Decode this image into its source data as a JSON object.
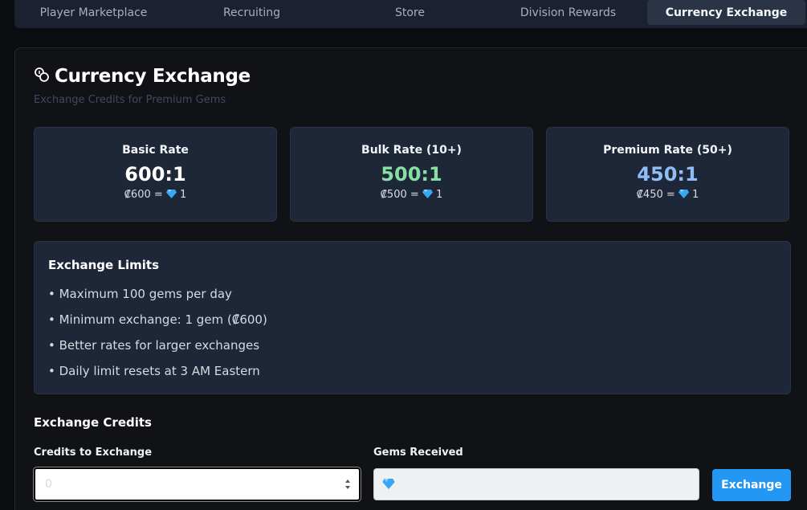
{
  "tabs": [
    {
      "label": "Player Marketplace"
    },
    {
      "label": "Recruiting"
    },
    {
      "label": "Store"
    },
    {
      "label": "Division Rewards"
    },
    {
      "label": "Currency Exchange",
      "active": true
    }
  ],
  "header": {
    "title": "Currency Exchange",
    "subtitle": "Exchange Credits for Premium Gems"
  },
  "rates": [
    {
      "name": "Basic Rate",
      "value": "600:1",
      "eq_credits": "₡600 =",
      "eq_gems": "1",
      "color": "#ffffff"
    },
    {
      "name": "Bulk Rate (10+)",
      "value": "500:1",
      "eq_credits": "₡500 =",
      "eq_gems": "1",
      "color": "#84e1a3"
    },
    {
      "name": "Premium Rate (50+)",
      "value": "450:1",
      "eq_credits": "₡450 =",
      "eq_gems": "1",
      "color": "#8fbdf5"
    }
  ],
  "limits": {
    "title": "Exchange Limits",
    "items": [
      "• Maximum 100 gems per day",
      "• Minimum exchange: 1 gem (₡600)",
      "• Better rates for larger exchanges",
      "• Daily limit resets at 3 AM Eastern"
    ]
  },
  "exchange": {
    "section_title": "Exchange Credits",
    "credits_label": "Credits to Exchange",
    "credits_placeholder": "0",
    "credits_value": "",
    "gems_label": "Gems Received",
    "gems_value": "",
    "button_label": "Exchange"
  },
  "colors": {
    "accent": "#2496f3",
    "card_bg": "#1e2738",
    "bulk_green": "#84e1a3",
    "premium_blue": "#8fbdf5"
  }
}
